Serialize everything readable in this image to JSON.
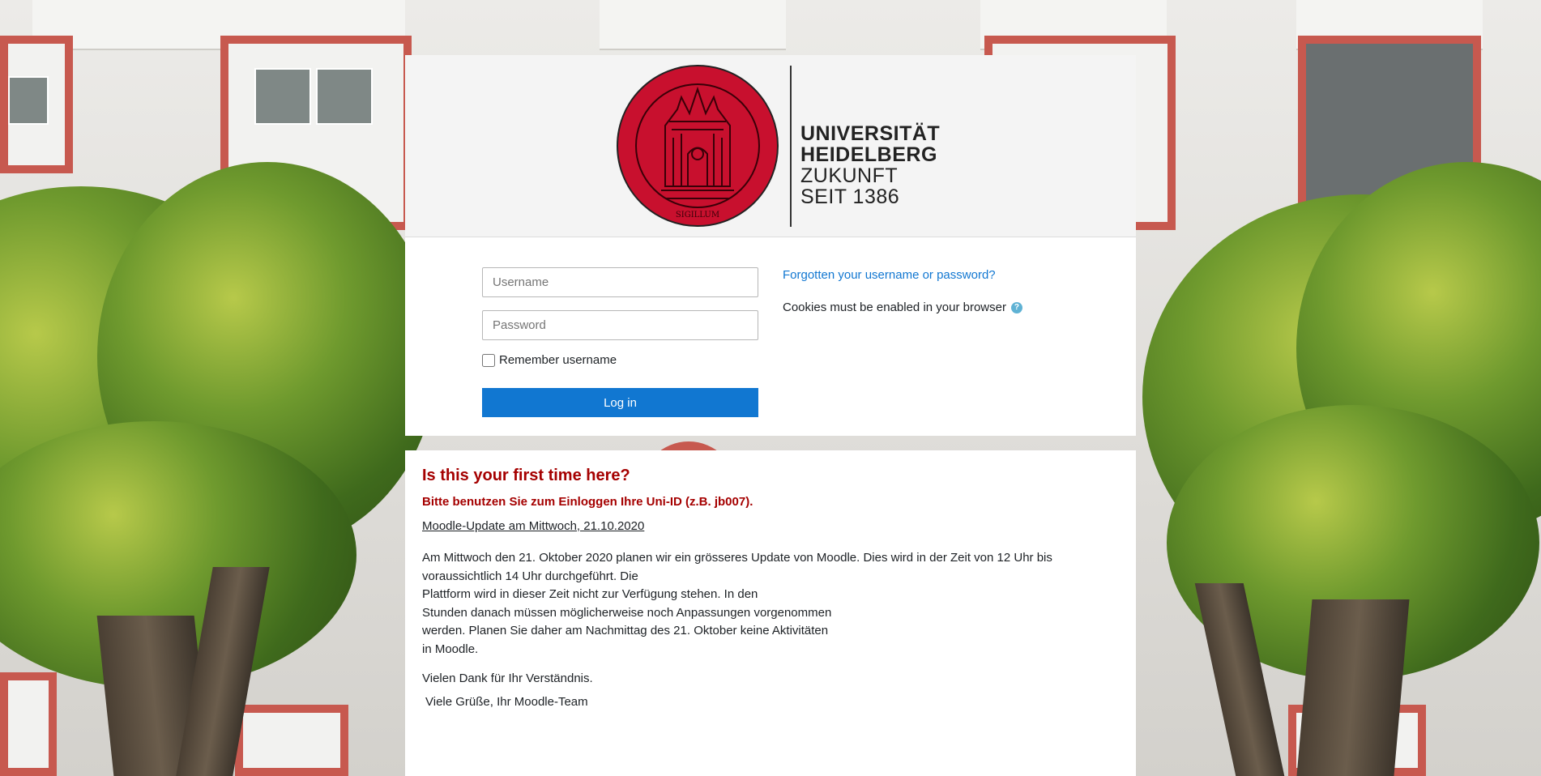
{
  "logo": {
    "line1": "UNIVERSITÄT",
    "line2": "HEIDELBERG",
    "line3": "ZUKUNFT",
    "line4": "SEIT 1386",
    "seal_color": "#c8102e"
  },
  "login": {
    "username_placeholder": "Username",
    "password_placeholder": "Password",
    "remember_label": "Remember username",
    "login_button": "Log in",
    "forgot_link": "Forgotten your username or password?",
    "cookies_text": "Cookies must be enabled in your browser",
    "accent_color": "#1177d1"
  },
  "info": {
    "heading": "Is this your first time here?",
    "uni_id_note": "Bitte benutzen Sie zum Einloggen Ihre Uni-ID (z.B. jb007).",
    "update_title": "Moodle-Update am Mittwoch, 21.10.2020",
    "lines": [
      "Am  Mittwoch den 21. Oktober 2020 planen wir ein grösseres Update von Moodle. Dies wird in der Zeit von 12 Uhr bis",
      "voraussichtlich 14 Uhr durchgeführt. Die",
      "Plattform wird in dieser Zeit nicht zur Verfügung stehen. In den",
      "Stunden danach müssen möglicherweise noch Anpassungen vorgenommen",
      "werden. Planen Sie daher am Nachmittag des 21. Oktober keine Aktivitäten",
      "in Moodle."
    ],
    "thanks": "Vielen Dank für Ihr Verständnis.",
    "regards": "Viele Grüße, Ihr Moodle-Team"
  }
}
